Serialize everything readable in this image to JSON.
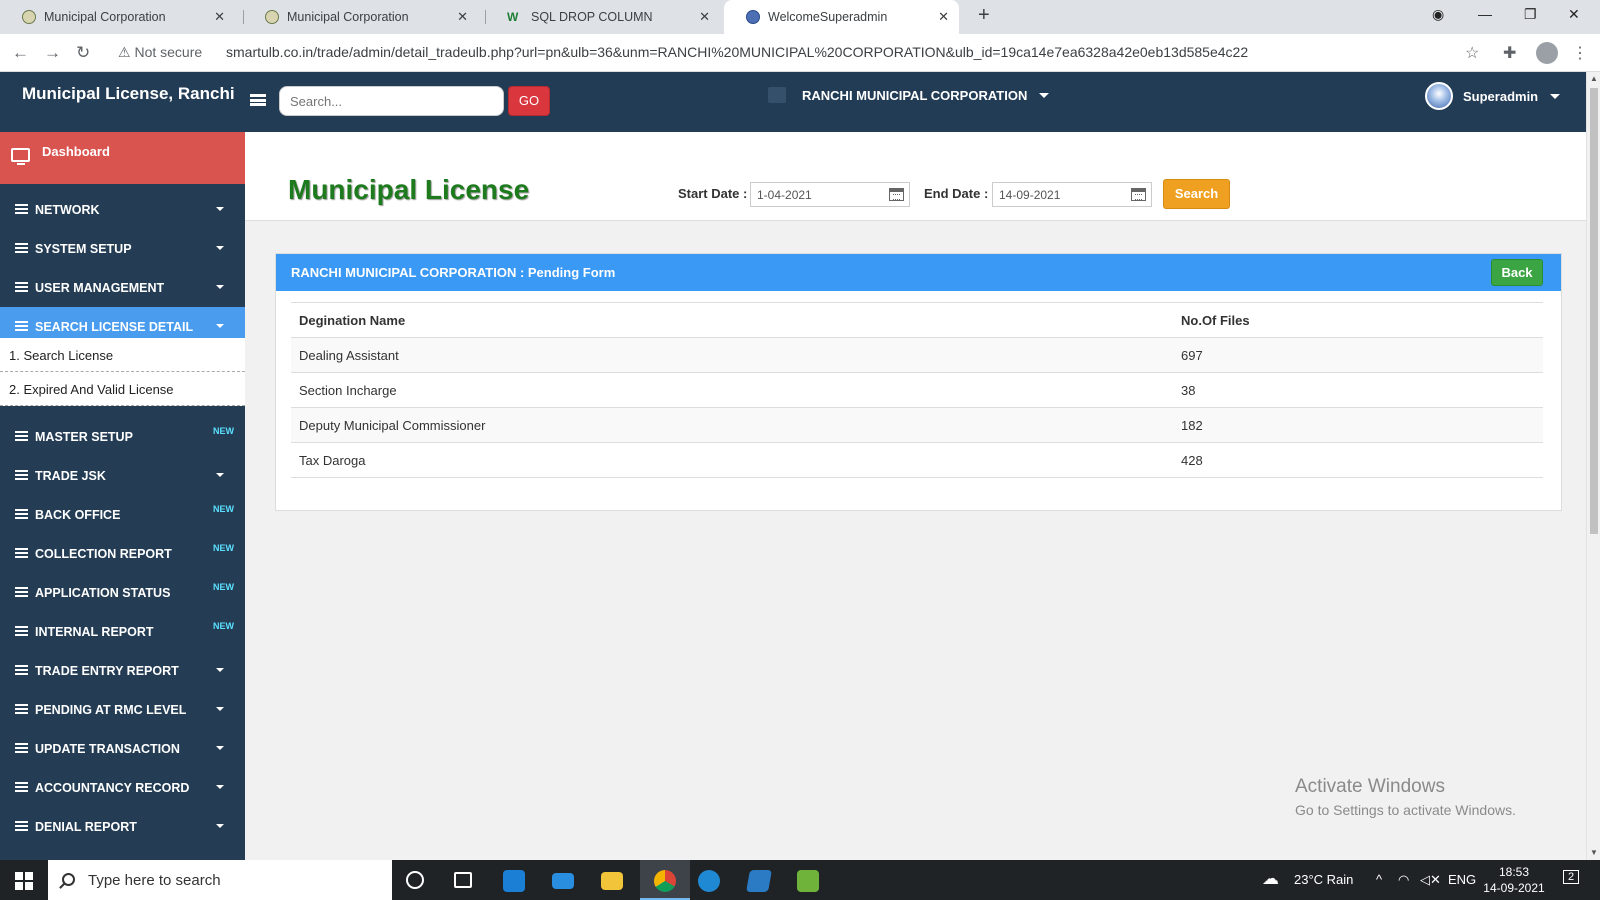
{
  "browser": {
    "tabs": [
      {
        "title": "Municipal Corporation",
        "icon": "seal-icon"
      },
      {
        "title": "Municipal Corporation",
        "icon": "seal-icon"
      },
      {
        "title": "SQL DROP COLUMN",
        "icon": "w3-icon",
        "badge": "W"
      },
      {
        "title": "WelcomeSuperadmin",
        "icon": "globe-icon"
      }
    ],
    "security_label": "Not secure",
    "url": "smartulb.co.in/trade/admin/detail_tradeulb.php?url=pn&ulb=36&unm=RANCHI%20MUNICIPAL%20CORPORATION&ulb_id=19ca14e7ea6328a42e0eb13d585e4c22"
  },
  "header": {
    "brand": "Municipal License, Ranchi",
    "search_placeholder": "Search...",
    "go_label": "GO",
    "corporation": "RANCHI MUNICIPAL CORPORATION",
    "user_name": "Superadmin"
  },
  "sidebar": {
    "dashboard_label": "Dashboard",
    "items": [
      {
        "label": "NETWORK",
        "kind": "dropdown"
      },
      {
        "label": "SYSTEM SETUP",
        "kind": "dropdown"
      },
      {
        "label": "USER MANAGEMENT",
        "kind": "dropdown"
      },
      {
        "label": "SEARCH LICENSE DETAIL",
        "kind": "dropdown",
        "active": true
      },
      {
        "label": "MASTER SETUP",
        "kind": "new"
      },
      {
        "label": "TRADE JSK",
        "kind": "dropdown"
      },
      {
        "label": "BACK OFFICE",
        "kind": "new"
      },
      {
        "label": "COLLECTION REPORT",
        "kind": "new"
      },
      {
        "label": "APPLICATION STATUS",
        "kind": "new"
      },
      {
        "label": "INTERNAL REPORT",
        "kind": "new"
      },
      {
        "label": "TRADE ENTRY REPORT",
        "kind": "dropdown"
      },
      {
        "label": "PENDING AT RMC LEVEL",
        "kind": "dropdown"
      },
      {
        "label": "UPDATE TRANSACTION",
        "kind": "dropdown"
      },
      {
        "label": "ACCOUNTANCY RECORD",
        "kind": "dropdown"
      },
      {
        "label": "DENIAL REPORT",
        "kind": "dropdown"
      }
    ],
    "subitems": [
      "1. Search License",
      "2. Expired And Valid License"
    ],
    "new_badge": "NEW"
  },
  "main": {
    "title": "Municipal License",
    "start_date_label": "Start Date :",
    "start_date": "1-04-2021",
    "end_date_label": "End Date :",
    "end_date": "14-09-2021",
    "search_label": "Search",
    "panel_title": "RANCHI MUNICIPAL CORPORATION : Pending Form",
    "back_label": "Back",
    "table": {
      "headers": [
        "Degination Name",
        "No.Of Files"
      ],
      "rows": [
        [
          "Dealing Assistant",
          "697"
        ],
        [
          "Section Incharge",
          "38"
        ],
        [
          "Deputy Municipal Commissioner",
          "182"
        ],
        [
          "Tax Daroga",
          "428"
        ]
      ]
    }
  },
  "watermark": {
    "line1": "Activate Windows",
    "line2": "Go to Settings to activate Windows."
  },
  "taskbar": {
    "search_placeholder": "Type here to search",
    "weather": "23°C  Rain",
    "language": "ENG",
    "time": "18:53",
    "date": "14-09-2021",
    "notifications": "2"
  },
  "colors": {
    "header_bg": "#233c55",
    "sidebar_bg": "#243d55",
    "dashboard_bg": "#d9534f",
    "active_item": "#4a9cee",
    "title_green": "#1d7a1d",
    "panel_blue": "#3a99f4"
  }
}
